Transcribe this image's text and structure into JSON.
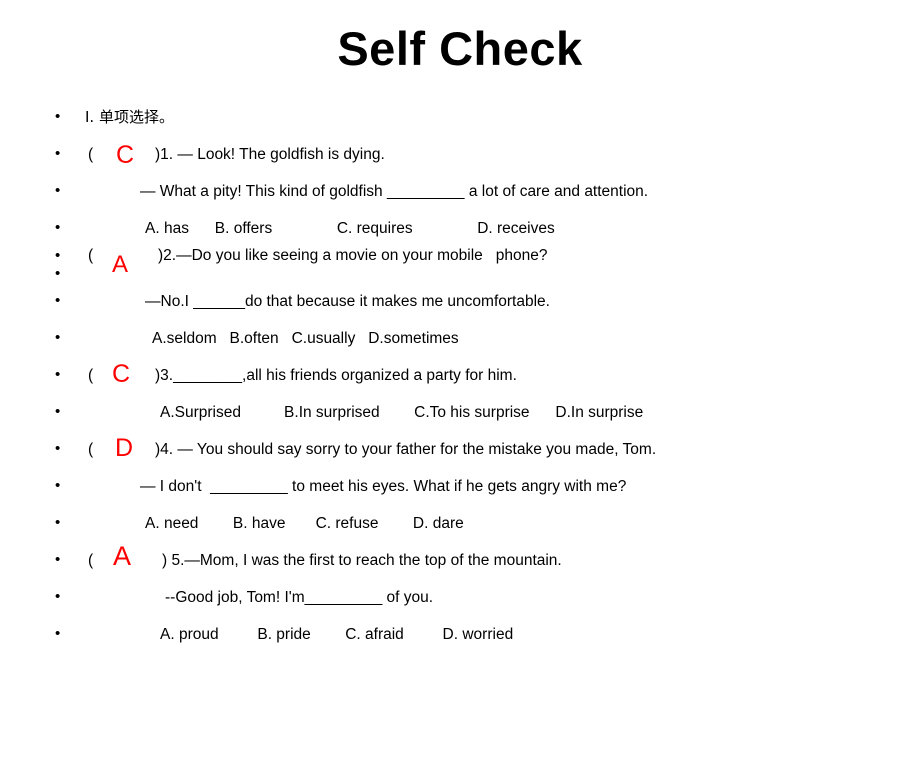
{
  "slide": {
    "title": "Self Check",
    "section_heading": "I. 单项选择。",
    "bullet_glyph": "•",
    "answer_color": "#ff0000"
  },
  "questions": [
    {
      "id": "q1",
      "answer": "C",
      "stem_prefix": "(",
      "stem": ")1. — Look! The goldfish is dying.",
      "lines": [
        "— What a pity! This kind of goldfish _________ a lot of care and attention."
      ],
      "options": "A. has      B. offers               C. requires               D. receives"
    },
    {
      "id": "q2",
      "answer": "A",
      "stem_prefix": "(",
      "stem": ")2.—Do you like seeing a movie on your mobile   phone?",
      "lines": [
        "—No.I ______do that because it makes me uncomfortable."
      ],
      "options": "A.seldom   B.often   C.usually   D.sometimes"
    },
    {
      "id": "q3",
      "answer": "C",
      "stem_prefix": "(",
      "stem": ")3.________,all his friends organized a party for him.",
      "lines": [],
      "options": "A.Surprised          B.In surprised        C.To his surprise      D.In surprise"
    },
    {
      "id": "q4",
      "answer": "D",
      "stem_prefix": "(",
      "stem": ")4. — You should say sorry to your father for the mistake you made, Tom.",
      "lines": [
        "— I don't  _________ to meet his eyes. What if he gets angry with me?"
      ],
      "options": "A. need        B. have       C. refuse        D. dare"
    },
    {
      "id": "q5",
      "answer": "A",
      "stem_prefix": "(",
      "stem": ") 5.—Mom, I was the first to reach the top of the mountain.",
      "lines": [
        "--Good job, Tom! I'm_________ of you."
      ],
      "options": "A. proud         B. pride        C. afraid         D. worried"
    }
  ]
}
